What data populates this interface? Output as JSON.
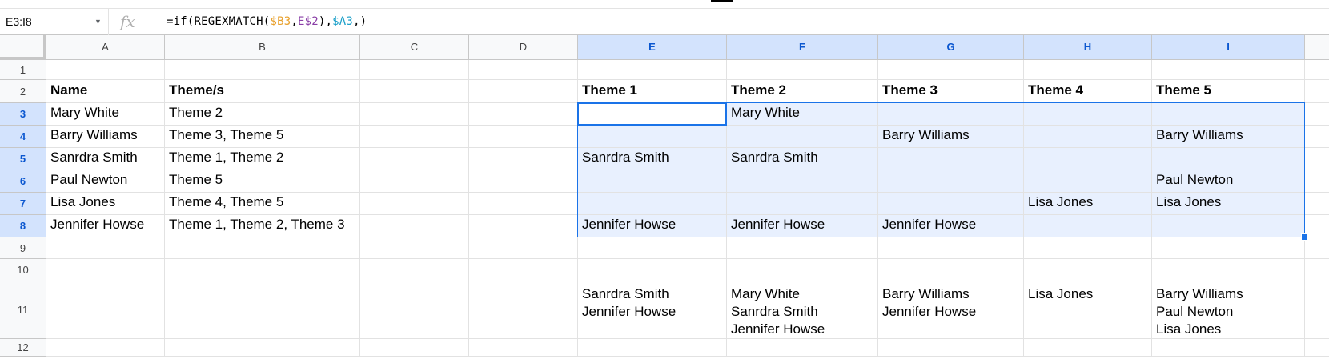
{
  "formula_bar": {
    "name_box": "E3:I8",
    "fx_icon": "fx",
    "formula_parts": [
      {
        "text": "=if(REGEXMATCH(",
        "ref": false
      },
      {
        "text": "$B3",
        "ref": "b3"
      },
      {
        "text": ",",
        "ref": false
      },
      {
        "text": "E$2",
        "ref": "e2"
      },
      {
        "text": "),",
        "ref": false
      },
      {
        "text": "$A3",
        "ref": "a3"
      },
      {
        "text": ",)",
        "ref": false
      }
    ]
  },
  "colors": {
    "selection_border": "#1a73e8",
    "selection_fill": "#e8f0fe",
    "header_selected": "#d3e3fd"
  },
  "sheet": {
    "columns": [
      "A",
      "B",
      "C",
      "D",
      "E",
      "F",
      "G",
      "H",
      "I"
    ],
    "rows": [
      "1",
      "2",
      "3",
      "4",
      "5",
      "6",
      "7",
      "8",
      "9",
      "10",
      "11",
      "12"
    ],
    "selected_columns": [
      "E",
      "F",
      "G",
      "H",
      "I"
    ],
    "selected_rows": [
      "3",
      "4",
      "5",
      "6",
      "7",
      "8"
    ],
    "cells": [
      [
        "",
        "",
        "",
        "",
        "",
        "",
        "",
        "",
        ""
      ],
      [
        "Name",
        "Theme/s",
        "",
        "",
        "Theme 1",
        "Theme 2",
        "Theme 3",
        "Theme 4",
        "Theme 5"
      ],
      [
        "Mary White",
        "Theme 2",
        "",
        "",
        "",
        "Mary White",
        "",
        "",
        ""
      ],
      [
        "Barry Williams",
        "Theme 3, Theme 5",
        "",
        "",
        "",
        "",
        "Barry Williams",
        "",
        "Barry Williams"
      ],
      [
        "Sanrdra Smith",
        "Theme 1, Theme 2",
        "",
        "",
        "Sanrdra Smith",
        "Sanrdra Smith",
        "",
        "",
        ""
      ],
      [
        "Paul Newton",
        "Theme 5",
        "",
        "",
        "",
        "",
        "",
        "",
        "Paul Newton"
      ],
      [
        "Lisa Jones",
        "Theme 4, Theme 5",
        "",
        "",
        "",
        "",
        "",
        "Lisa Jones",
        "Lisa Jones"
      ],
      [
        "Jennifer Howse",
        "Theme 1, Theme 2, Theme 3",
        "",
        "",
        "Jennifer Howse",
        "Jennifer Howse",
        "Jennifer Howse",
        "",
        ""
      ],
      [
        "",
        "",
        "",
        "",
        "",
        "",
        "",
        "",
        ""
      ],
      [
        "",
        "",
        "",
        "",
        "",
        "",
        "",
        "",
        ""
      ],
      [
        "",
        "",
        "",
        "",
        "Sanrdra Smith\nJennifer Howse",
        "Mary White\nSanrdra Smith\nJennifer Howse",
        "Barry Williams\nJennifer Howse",
        "Lisa Jones",
        "Barry Williams\nPaul Newton\nLisa Jones"
      ],
      [
        "",
        "",
        "",
        "",
        "",
        "",
        "",
        "",
        ""
      ]
    ]
  }
}
